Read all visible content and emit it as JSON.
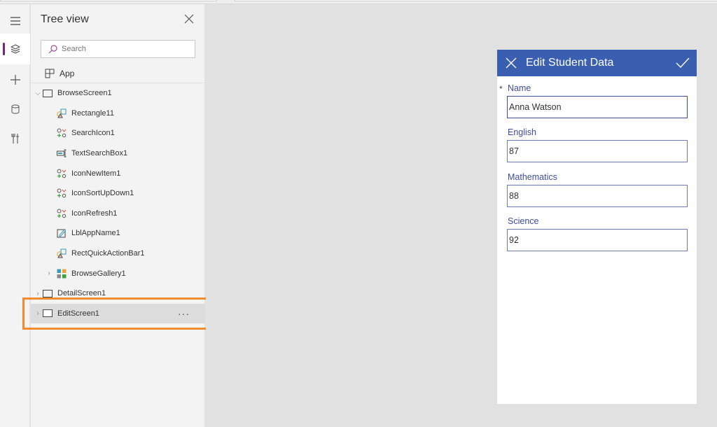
{
  "tree_view": {
    "title": "Tree view",
    "search_placeholder": "Search",
    "app_label": "App",
    "nodes": [
      {
        "label": "BrowseScreen1",
        "level": 0,
        "chevron": "down",
        "icon": "screen-icon"
      },
      {
        "label": "Rectangle11",
        "level": 1,
        "icon": "shape-icon"
      },
      {
        "label": "SearchIcon1",
        "level": 1,
        "icon": "icons-control-icon"
      },
      {
        "label": "TextSearchBox1",
        "level": 1,
        "icon": "text-input-icon"
      },
      {
        "label": "IconNewItem1",
        "level": 1,
        "icon": "icons-control-icon"
      },
      {
        "label": "IconSortUpDown1",
        "level": 1,
        "icon": "icons-control-icon"
      },
      {
        "label": "IconRefresh1",
        "level": 1,
        "icon": "icons-control-icon"
      },
      {
        "label": "LblAppName1",
        "level": 1,
        "icon": "label-icon"
      },
      {
        "label": "RectQuickActionBar1",
        "level": 1,
        "icon": "shape-icon"
      },
      {
        "label": "BrowseGallery1",
        "level": 1,
        "chevron": "right",
        "icon": "gallery-icon"
      },
      {
        "label": "DetailScreen1",
        "level": 0,
        "chevron": "right",
        "icon": "screen-icon"
      },
      {
        "label": "EditScreen1",
        "level": 0,
        "chevron": "right",
        "icon": "screen-icon",
        "selected": true
      }
    ],
    "more_label": "···"
  },
  "rail": {
    "items": [
      "menu-icon",
      "layers-icon",
      "add-icon",
      "data-icon",
      "tools-icon"
    ],
    "active": "layers-icon"
  },
  "form": {
    "title": "Edit Student Data",
    "required_marker": "*",
    "fields": [
      {
        "label": "Name",
        "value": "Anna Watson",
        "required": true
      },
      {
        "label": "English",
        "value": "87"
      },
      {
        "label": "Mathematics",
        "value": "88"
      },
      {
        "label": "Science",
        "value": "92"
      }
    ]
  },
  "colors": {
    "accent": "#742774",
    "form_header": "#3b5fb0",
    "highlight": "#f28a30",
    "label_text": "#3c4e9a"
  }
}
